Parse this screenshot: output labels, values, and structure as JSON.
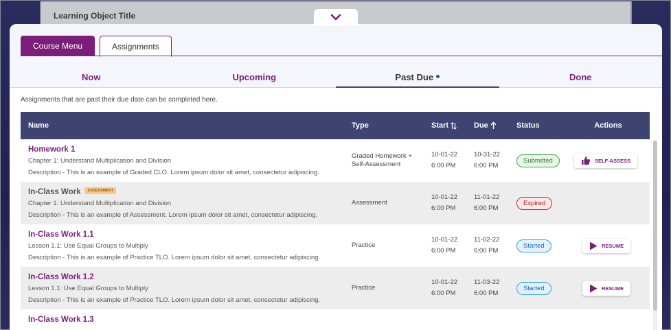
{
  "learning_object": {
    "title": "Learning Object Title"
  },
  "tabs": [
    {
      "label": "Course Menu",
      "active": true
    },
    {
      "label": "Assignments",
      "active": false
    }
  ],
  "subtabs": [
    {
      "label": "Now"
    },
    {
      "label": "Upcoming"
    },
    {
      "label": "Past Due",
      "active": true
    },
    {
      "label": "Done"
    }
  ],
  "info_text": "Assignments that are past their due date can be completed here.",
  "table": {
    "headers": {
      "name": "Name",
      "type": "Type",
      "start": "Start",
      "due": "Due",
      "status": "Status",
      "actions": "Actions"
    },
    "rows": [
      {
        "name": "Homework 1",
        "subtitle": "Chapter 1: Understand Multiplication and Division",
        "description": "Description - This is an example of Graded CLO. Lorem ipsum dolor sit amet, consectetur adipiscing.",
        "type_line1": "Graded Homework +",
        "type_line2": "Self-Assessment",
        "start_date": "10-01-22",
        "start_time": "6:00 PM",
        "due_date": "10-31-22",
        "due_time": "6:00 PM",
        "status": "Submitted",
        "action": "SELF-ASSESS"
      },
      {
        "name": "In-Class Work",
        "tag": "ASSESSMENT",
        "subtitle": "Chapter 1: Understand Multiplication and Division",
        "description": "Description - This is an example of Assessment. Lorem ipsum dolor sit amet, consectetur adipiscing.",
        "type_line1": "Assessment",
        "start_date": "10-01-22",
        "start_time": "6:00 PM",
        "due_date": "11-01-22",
        "due_time": "6:00 PM",
        "status": "Expired"
      },
      {
        "name": "In-Class Work 1.1",
        "subtitle": "Lesson 1.1: Use Equal Groups to Multiply",
        "description": "Description - This is an example of Practice TLO. Lorem ipsum dolor sit amet, consectetur adipiscing.",
        "type_line1": "Practice",
        "start_date": "10-01-22",
        "start_time": "6:00 PM",
        "due_date": "11-02-22",
        "due_time": "6:00 PM",
        "status": "Started",
        "action": "RESUME"
      },
      {
        "name": "In-Class Work 1.2",
        "subtitle": "Lesson 1.1: Use Equal Groups to Multiply",
        "description": "Description - This is an example of Practice TLO. Lorem ipsum dolor sit amet, consectetur adipiscing.",
        "type_line1": "Practice",
        "start_date": "10-01-22",
        "start_time": "6:00 PM",
        "due_date": "11-03-22",
        "due_time": "6:00 PM",
        "status": "Started",
        "action": "RESUME"
      },
      {
        "name": "In-Class Work 1.3"
      }
    ]
  },
  "colors": {
    "accent": "#7b1e7a",
    "header_bg": "#3f4370",
    "submitted": "#43a047",
    "expired": "#c62828",
    "started": "#29a5e5"
  },
  "icons": {
    "collapse": "chevron-down-icon",
    "self_assess": "thumbs-up-icon",
    "resume": "play-icon",
    "sort_start": "sort-arrows-icon",
    "sort_due": "arrow-up-icon"
  }
}
